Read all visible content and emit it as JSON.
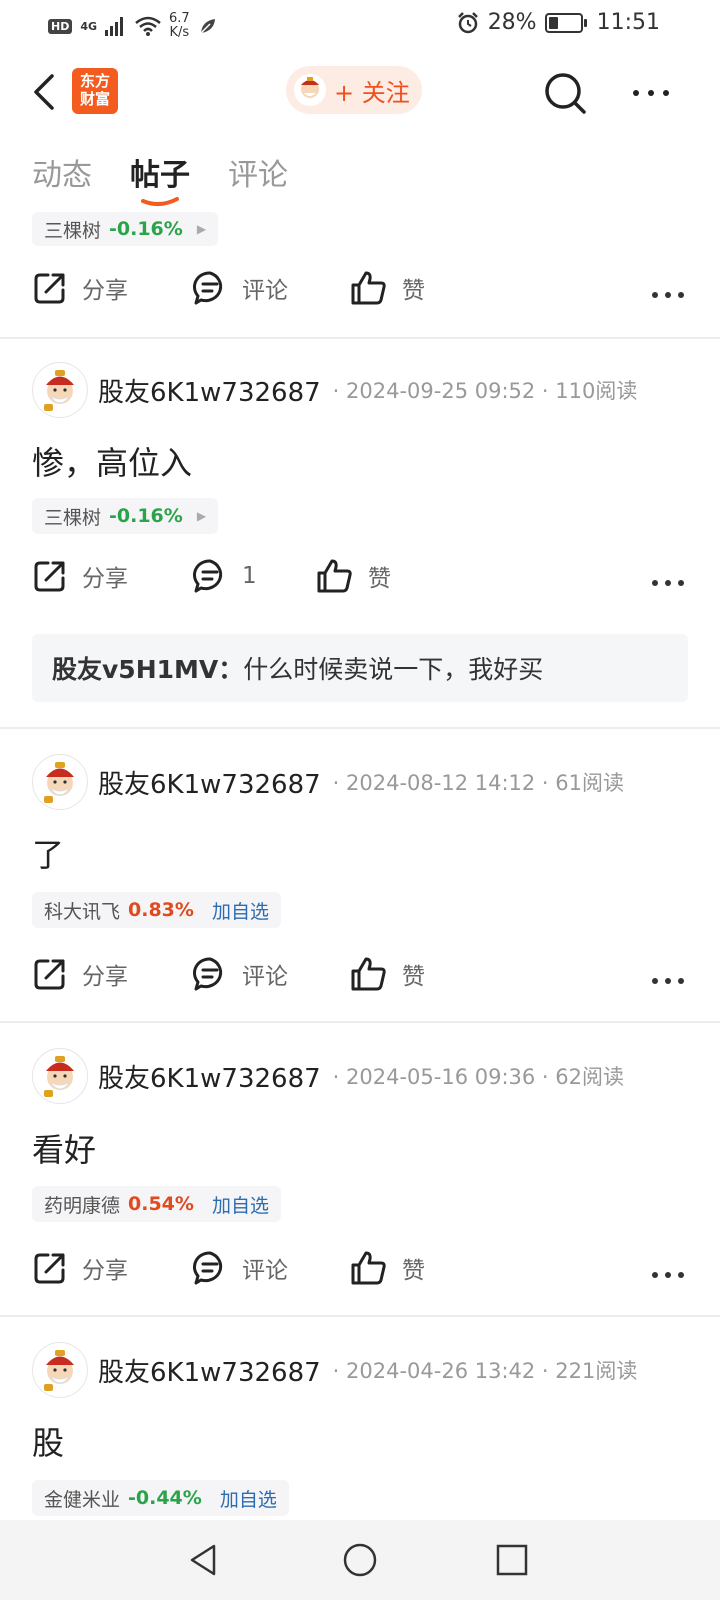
{
  "status_bar": {
    "hd": "HD",
    "network": "4G",
    "speed_top": "6.7",
    "speed_bottom": "K/s",
    "battery": "28%",
    "time": "11:51"
  },
  "header": {
    "logo_line1": "东方",
    "logo_line2": "财富",
    "follow_label": "+ 关注"
  },
  "tabs": [
    {
      "label": "动态"
    },
    {
      "label": "帖子"
    },
    {
      "label": "评论"
    }
  ],
  "actions": {
    "share": "分享",
    "comment": "评论",
    "like": "赞"
  },
  "posts": [
    {
      "tag": {
        "name": "三棵树",
        "pct": "-0.16%"
      }
    },
    {
      "user": "股友6K1w732687",
      "meta": "· 2024-09-25 09:52 · 110阅读",
      "body": "惨，高位入",
      "tag": {
        "name": "三棵树",
        "pct": "-0.16%"
      },
      "comment_count": "1",
      "reply_user": "股友v5H1MV：",
      "reply_text": "什么时候卖说一下，我好买"
    },
    {
      "user": "股友6K1w732687",
      "meta": "· 2024-08-12 14:12 · 61阅读",
      "body": "了",
      "tag": {
        "name": "科大讯飞",
        "pct": "0.83%",
        "add": "加自选"
      }
    },
    {
      "user": "股友6K1w732687",
      "meta": "· 2024-05-16 09:36 · 62阅读",
      "body": "看好",
      "tag": {
        "name": "药明康德",
        "pct": "0.54%",
        "add": "加自选"
      }
    },
    {
      "user": "股友6K1w732687",
      "meta": "· 2024-04-26 13:42 · 221阅读",
      "body": "股",
      "tag": {
        "name": "金健米业",
        "pct": "-0.44%",
        "add": "加自选"
      }
    }
  ],
  "colors": {
    "brand": "#f35b1f",
    "down": "#2aa34a",
    "up": "#e04a1f",
    "link": "#2c6cb0"
  }
}
